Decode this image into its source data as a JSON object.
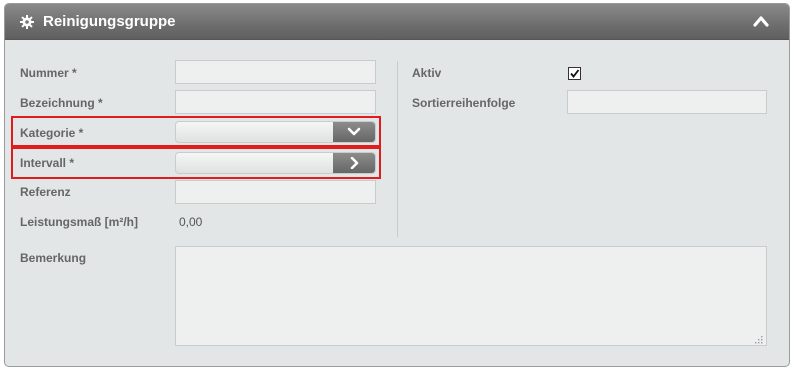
{
  "panel": {
    "title": "Reinigungsgruppe",
    "header_icon": "gear-icon",
    "collapse_icon": "chevron-up-icon"
  },
  "fields": {
    "nummer": {
      "label": "Nummer *",
      "value": ""
    },
    "bezeichnung": {
      "label": "Bezeichnung *",
      "value": ""
    },
    "kategorie": {
      "label": "Kategorie *",
      "value": "",
      "button_icon": "chevron-down-icon"
    },
    "intervall": {
      "label": "Intervall *",
      "value": "",
      "button_icon": "chevron-right-icon"
    },
    "referenz": {
      "label": "Referenz",
      "value": ""
    },
    "leistungsmass": {
      "label": "Leistungsmaß [m²/h]",
      "value": "0,00"
    },
    "aktiv": {
      "label": "Aktiv",
      "checked": true
    },
    "sortierreihenfolge": {
      "label": "Sortierreihenfolge",
      "value": ""
    },
    "bemerkung": {
      "label": "Bemerkung",
      "value": ""
    }
  },
  "colors": {
    "header": "#6e6e6e",
    "panel_background": "#e2e6e6",
    "highlight": "#e01c1c",
    "label": "#666666"
  }
}
